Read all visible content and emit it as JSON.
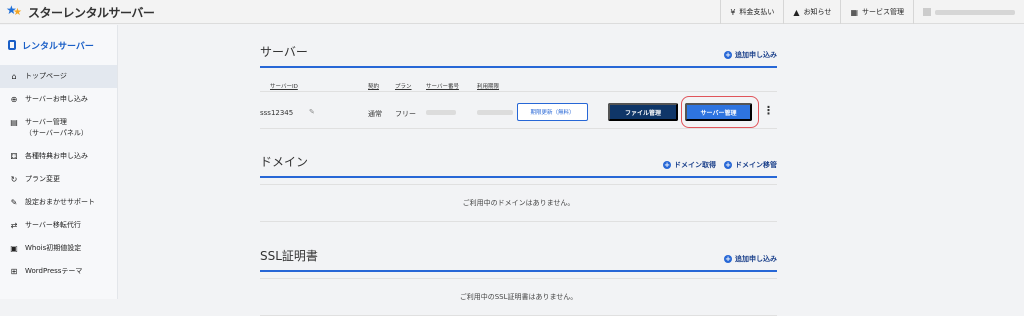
{
  "header": {
    "brand": "スターレンタルサーバー",
    "nav": [
      {
        "icon": "¥",
        "icon_name": "yen-icon",
        "label": "料金支払い"
      },
      {
        "icon": "🔔",
        "icon_name": "bell-icon",
        "label": "お知らせ"
      },
      {
        "icon": "▦",
        "icon_name": "grid-icon",
        "label": "サービス管理"
      }
    ]
  },
  "sidebar": {
    "title": "レンタルサーバー",
    "items": [
      {
        "icon": "⌂",
        "icon_name": "home-icon",
        "label": "トップページ",
        "sub": ""
      },
      {
        "icon": "⊕",
        "icon_name": "plus-circle-icon",
        "label": "サーバーお申し込み",
        "sub": ""
      },
      {
        "icon": "▤",
        "icon_name": "server-icon",
        "label": "サーバー管理",
        "sub": "（サーバーパネル）"
      },
      {
        "icon": "⚃",
        "icon_name": "gift-icon",
        "label": "各種特典お申し込み",
        "sub": ""
      },
      {
        "icon": "↻",
        "icon_name": "refresh-icon",
        "label": "プラン変更",
        "sub": ""
      },
      {
        "icon": "✎",
        "icon_name": "wrench-icon",
        "label": "設定おまかせサポート",
        "sub": ""
      },
      {
        "icon": "⇄",
        "icon_name": "transfer-icon",
        "label": "サーバー移転代行",
        "sub": ""
      },
      {
        "icon": "▣",
        "icon_name": "whois-icon",
        "label": "Whois初期値設定",
        "sub": ""
      },
      {
        "icon": "⊞",
        "icon_name": "wordpress-theme-icon",
        "label": "WordPressテーマ",
        "sub": ""
      }
    ]
  },
  "server": {
    "title": "サーバー",
    "add_link": "追加申し込み",
    "columns": [
      "サーバーID",
      "契約",
      "プラン",
      "サーバー番号",
      "利用期限"
    ],
    "row": {
      "server_id": "sss12345",
      "contract": "通常",
      "plan": "フリー"
    },
    "buttons": {
      "renew": "期限更新（無料）",
      "file": "ファイル管理",
      "manage": "サーバー管理"
    }
  },
  "domain": {
    "title": "ドメイン",
    "link_get": "ドメイン取得",
    "link_transfer": "ドメイン移管",
    "empty": "ご利用中のドメインはありません。"
  },
  "ssl": {
    "title": "SSL証明書",
    "add_link": "追加申し込み",
    "empty": "ご利用中のSSL証明書はありません。"
  }
}
